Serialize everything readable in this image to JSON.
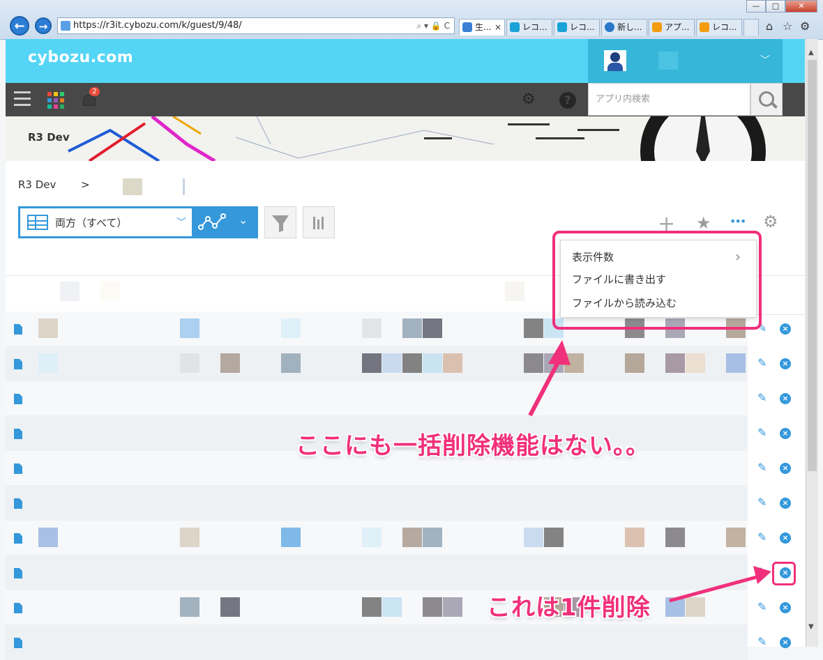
{
  "browser": {
    "url": "https://r3it.cybozu.com/k/guest/9/48/",
    "address_tools": "⌕ ▾ 🔒 C",
    "tabs": [
      {
        "label": "生...",
        "close": "×",
        "active": true,
        "color": "#3a7fd5"
      },
      {
        "label": "レコ...",
        "color": "#1aa3d9"
      },
      {
        "label": "レコ...",
        "color": "#1aa3d9"
      },
      {
        "label": "新し...",
        "color": "#f2f2f2"
      },
      {
        "label": "アプ...",
        "color": "#f39c12"
      },
      {
        "label": "レコ...",
        "color": "#f39c12"
      }
    ],
    "back": "←",
    "forward": "→",
    "window_buttons": {
      "minimize": "—",
      "maximize": "□",
      "close": "✕"
    },
    "right_icons": {
      "home": "⌂",
      "favorites": "☆",
      "settings": "⚙"
    }
  },
  "app": {
    "logo": "cybozu.com",
    "notification_count": "2",
    "user_chevron": "﹀",
    "search_placeholder": "アプリ内検索",
    "settings_icon": "⚙",
    "help_icon": "?",
    "space_title": "R3 Dev",
    "breadcrumb": {
      "space": "R3 Dev",
      "separator": ">"
    },
    "view_name": "両方（すべて）",
    "view_chevron": "﹀",
    "graph_glyph": "⌄",
    "toolbar": {
      "add": "+",
      "favorite": "★",
      "more": "•••",
      "settings": "⚙",
      "filter": "⏷",
      "chart": "▥"
    }
  },
  "menu": {
    "items": [
      "表示件数",
      "ファイルに書き出す",
      "ファイルから読み込む"
    ],
    "submenu_arrow": "›"
  },
  "records": {
    "edit_glyph": "✎",
    "delete_glyph": "×"
  },
  "annotations": {
    "no_bulk_delete": "ここにも一括削除機能はない。。",
    "single_delete": "これは1件削除"
  },
  "colors": {
    "accent": "#3498db",
    "header": "#55d5f5",
    "callout": "#f0307a"
  }
}
